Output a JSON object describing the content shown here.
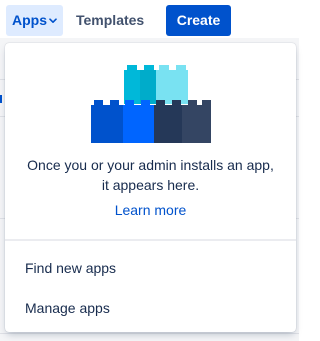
{
  "nav": {
    "apps_label": "Apps",
    "templates_label": "Templates",
    "create_label": "Create"
  },
  "dropdown": {
    "empty_message_line1": "Once you or your admin installs an app,",
    "empty_message_line2": "it appears here.",
    "learn_more": "Learn more",
    "menu_items": [
      {
        "label": "Find new apps"
      },
      {
        "label": "Manage apps"
      }
    ]
  },
  "icons": {
    "apps_chevron": "chevron-down-icon",
    "illustration": "building-blocks-illustration"
  },
  "colors": {
    "primary": "#0052cc",
    "selected_bg": "#deebff",
    "text": "#172b4d",
    "teal_block": "#00b8d9",
    "light_teal_block": "#79e2f2",
    "dark_block": "#344563"
  }
}
